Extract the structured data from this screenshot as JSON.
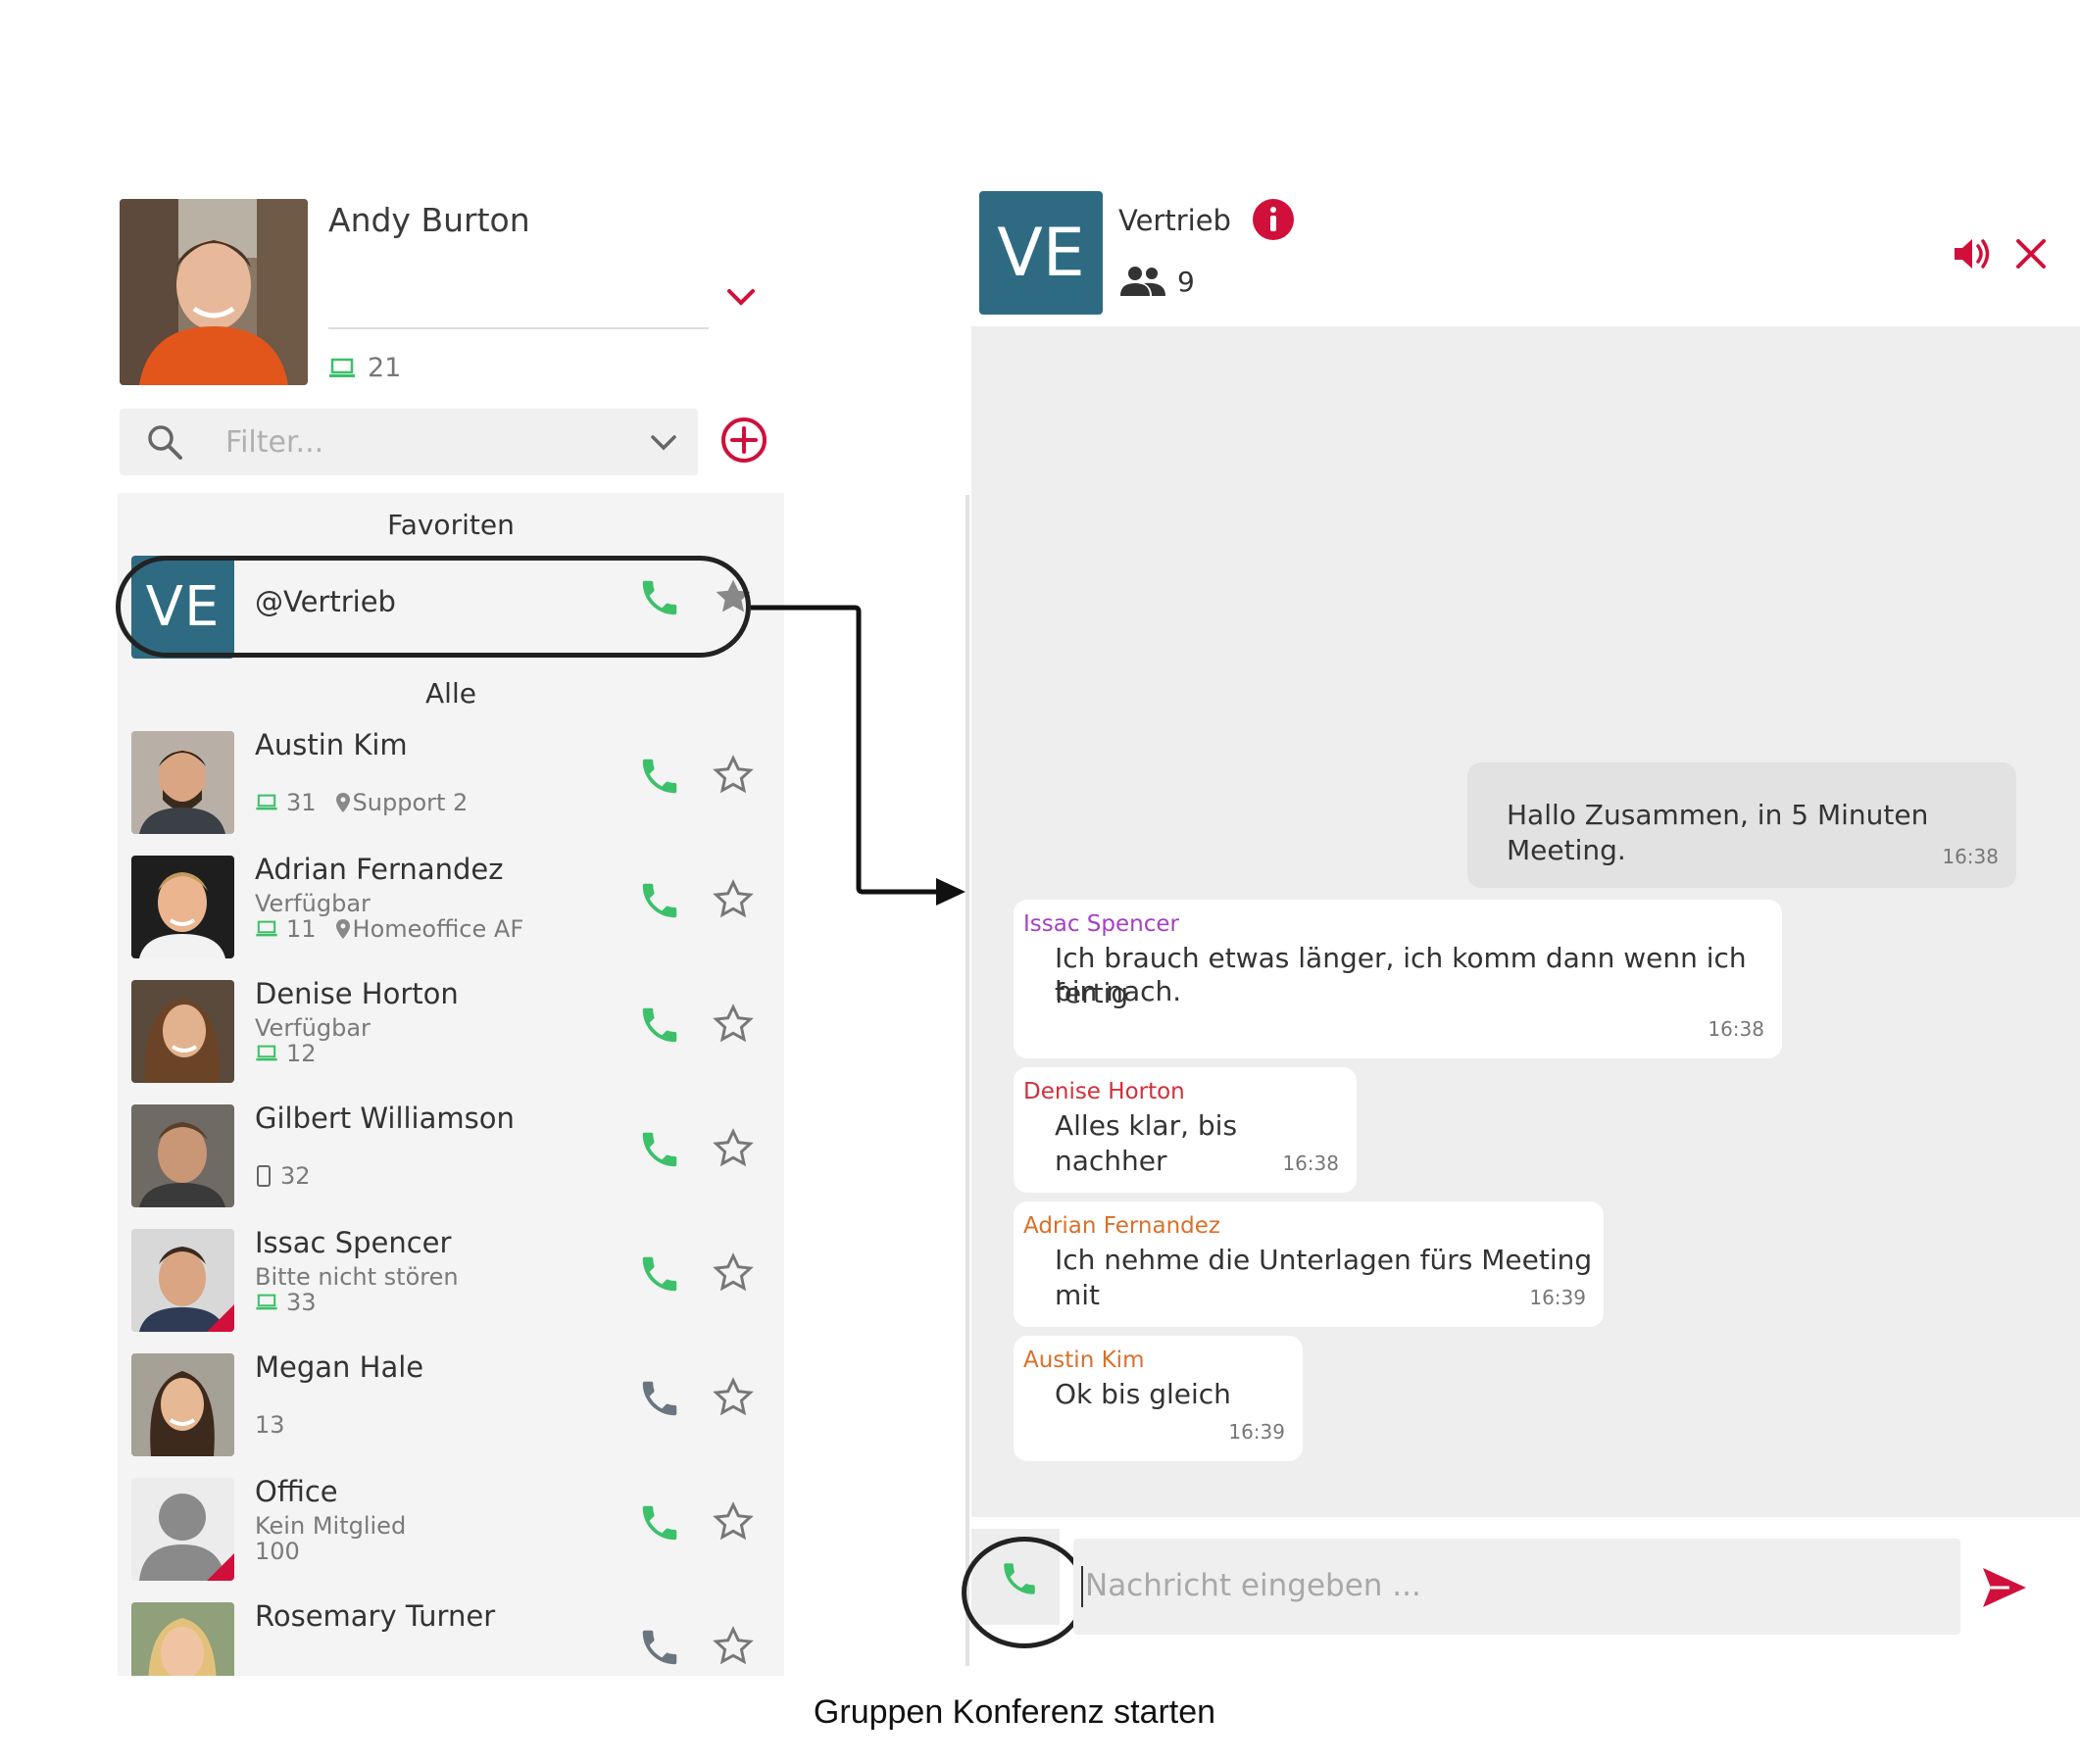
{
  "profile": {
    "name": "Andy Burton",
    "device_count": "21"
  },
  "filter": {
    "placeholder": "Filter..."
  },
  "sections": {
    "favorites": "Favoriten",
    "all": "Alle"
  },
  "favorite_group": {
    "initials": "VE",
    "name": "@Vertrieb"
  },
  "contacts": [
    {
      "name": "Austin Kim",
      "status": "",
      "device_icon": "laptop-icon",
      "count": "31",
      "location": "Support 2",
      "phone_active": true,
      "status_color": ""
    },
    {
      "name": "Adrian Fernandez",
      "status": "Verfügbar",
      "device_icon": "laptop-icon",
      "count": "11",
      "location": "Homeoffice AF",
      "phone_active": true,
      "status_color": ""
    },
    {
      "name": "Denise Horton",
      "status": "Verfügbar",
      "device_icon": "laptop-icon",
      "count": "12",
      "location": "",
      "phone_active": true,
      "status_color": ""
    },
    {
      "name": "Gilbert Williamson",
      "status": "",
      "device_icon": "mobile-icon",
      "count": "32",
      "location": "",
      "phone_active": true,
      "status_color": ""
    },
    {
      "name": "Issac Spencer",
      "status": "Bitte nicht stören",
      "device_icon": "laptop-icon",
      "count": "33",
      "location": "",
      "phone_active": true,
      "status_color": "#d0103a"
    },
    {
      "name": "Megan Hale",
      "status": "",
      "device_icon": "",
      "count": "13",
      "location": "",
      "phone_active": false,
      "status_color": ""
    },
    {
      "name": "Office",
      "status": "Kein Mitglied",
      "device_icon": "",
      "count": "100",
      "location": "",
      "phone_active": true,
      "status_color": "#d0103a"
    },
    {
      "name": "Rosemary Turner",
      "status": "",
      "device_icon": "",
      "count": "",
      "location": "",
      "phone_active": false,
      "status_color": ""
    }
  ],
  "chat": {
    "initials": "VE",
    "title": "Vertrieb",
    "member_count": "9",
    "messages": [
      {
        "sender": "",
        "text": "Hallo Zusammen, in 5 Minuten Meeting.",
        "time": "16:38",
        "mine": true
      },
      {
        "sender": "Issac Spencer",
        "sender_color": "#a63fc4",
        "text_line1": "Ich brauch etwas länger, ich komm dann wenn ich fertig",
        "text_line2": "bin nach.",
        "time": "16:38"
      },
      {
        "sender": "Denise Horton",
        "sender_color": "#d0303a",
        "text": "Alles klar, bis nachher",
        "time": "16:38"
      },
      {
        "sender": "Adrian Fernandez",
        "sender_color": "#d9702a",
        "text": "Ich nehme die Unterlagen fürs Meeting mit",
        "time": "16:39"
      },
      {
        "sender": "Austin Kim",
        "sender_color": "#d9702a",
        "text": "Ok bis gleich",
        "time": "16:39"
      }
    ],
    "composer_placeholder": "Nachricht eingeben ..."
  },
  "colors": {
    "accent_red": "#d0103a",
    "call_green": "#3cc06a",
    "call_grey": "#6b7580",
    "group_teal": "#2e6b82"
  },
  "caption": "Gruppen Konferenz starten"
}
